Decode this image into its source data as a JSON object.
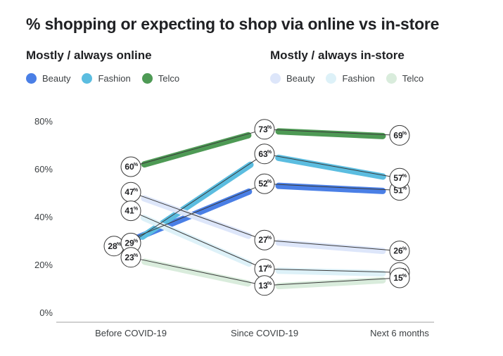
{
  "title": "% shopping or expecting to shop via online vs in-store",
  "groups": {
    "online": {
      "title": "Mostly / always online",
      "legend": [
        {
          "label": "Beauty",
          "color": "#4a7fe6"
        },
        {
          "label": "Fashion",
          "color": "#5bbde0"
        },
        {
          "label": "Telco",
          "color": "#4e9a55"
        }
      ]
    },
    "instore": {
      "title": "Mostly / always in-store",
      "legend": [
        {
          "label": "Beauty",
          "color": "#dde6fa"
        },
        {
          "label": "Fashion",
          "color": "#ddf1f8"
        },
        {
          "label": "Telco",
          "color": "#d9ecdc"
        }
      ]
    }
  },
  "chart_data": {
    "type": "line",
    "title": "% shopping or expecting to shop via online vs in-store",
    "categories": [
      "Before COVID-19",
      "Since COVID-19",
      "Next 6 months"
    ],
    "yticks": [
      "80%",
      "60%",
      "40%",
      "20%",
      "0%"
    ],
    "ylim": [
      0,
      80
    ],
    "grid": false,
    "legend_position": "top",
    "value_suffix": "%",
    "series": [
      {
        "name": "Beauty",
        "group": "Mostly / always online",
        "color": "#4a7fe6",
        "values": [
          28,
          52,
          51
        ]
      },
      {
        "name": "Fashion",
        "group": "Mostly / always online",
        "color": "#5bbde0",
        "values": [
          29,
          63,
          57
        ]
      },
      {
        "name": "Telco",
        "group": "Mostly / always online",
        "color": "#4e9a55",
        "values": [
          60,
          73,
          69
        ]
      },
      {
        "name": "Beauty",
        "group": "Mostly / always in-store",
        "color": "#dde6fa",
        "values": [
          47,
          27,
          26
        ]
      },
      {
        "name": "Fashion",
        "group": "Mostly / always in-store",
        "color": "#ddf1f8",
        "values": [
          41,
          17,
          17
        ]
      },
      {
        "name": "Telco",
        "group": "Mostly / always in-store",
        "color": "#d9ecdc",
        "values": [
          23,
          13,
          15
        ]
      }
    ]
  }
}
